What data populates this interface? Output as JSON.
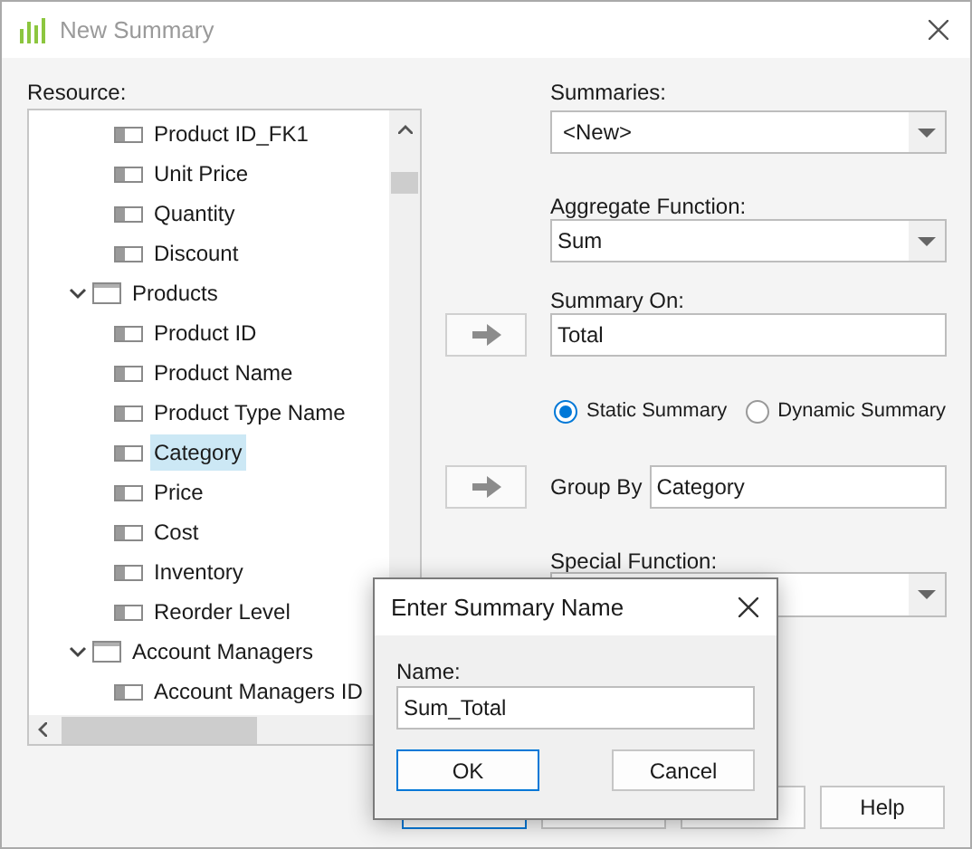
{
  "window": {
    "title": "New Summary"
  },
  "resource": {
    "label": "Resource:",
    "tree": [
      {
        "kind": "field",
        "label": "Product ID_FK1",
        "selected": false
      },
      {
        "kind": "field",
        "label": "Unit Price",
        "selected": false
      },
      {
        "kind": "field",
        "label": "Quantity",
        "selected": false
      },
      {
        "kind": "field",
        "label": "Discount",
        "selected": false
      },
      {
        "kind": "table",
        "label": "Products",
        "selected": false,
        "expanded": true,
        "children": [
          {
            "kind": "field",
            "label": "Product ID",
            "selected": false
          },
          {
            "kind": "field",
            "label": "Product Name",
            "selected": false
          },
          {
            "kind": "field",
            "label": "Product Type Name",
            "selected": false
          },
          {
            "kind": "field",
            "label": "Category",
            "selected": true
          },
          {
            "kind": "field",
            "label": "Price",
            "selected": false
          },
          {
            "kind": "field",
            "label": "Cost",
            "selected": false
          },
          {
            "kind": "field",
            "label": "Inventory",
            "selected": false
          },
          {
            "kind": "field",
            "label": "Reorder Level",
            "selected": false
          }
        ]
      },
      {
        "kind": "table",
        "label": "Account Managers",
        "selected": false,
        "expanded": true,
        "children": [
          {
            "kind": "field",
            "label": "Account Managers ID",
            "selected": false
          }
        ]
      }
    ]
  },
  "summaries": {
    "label": "Summaries:",
    "value": "<New>"
  },
  "aggregate_function": {
    "label": "Aggregate Function:",
    "value": "Sum"
  },
  "summary_on": {
    "label": "Summary On:",
    "value": "Total"
  },
  "summary_type": [
    {
      "label": "Static Summary",
      "selected": true
    },
    {
      "label": "Dynamic Summary",
      "selected": false
    }
  ],
  "group_by": {
    "label": "Group By",
    "value": "Category"
  },
  "special_function": {
    "label": "Special Function:"
  },
  "buttons": [
    {
      "default": true
    },
    {
      "default": false
    },
    {
      "default": false
    },
    {
      "label": "Help",
      "default": false
    }
  ],
  "modal": {
    "title": "Enter Summary Name",
    "name_label": "Name:",
    "name_value": "Sum_Total",
    "buttons": [
      {
        "label": "OK",
        "default": true
      },
      {
        "label": "Cancel",
        "default": false
      }
    ]
  }
}
